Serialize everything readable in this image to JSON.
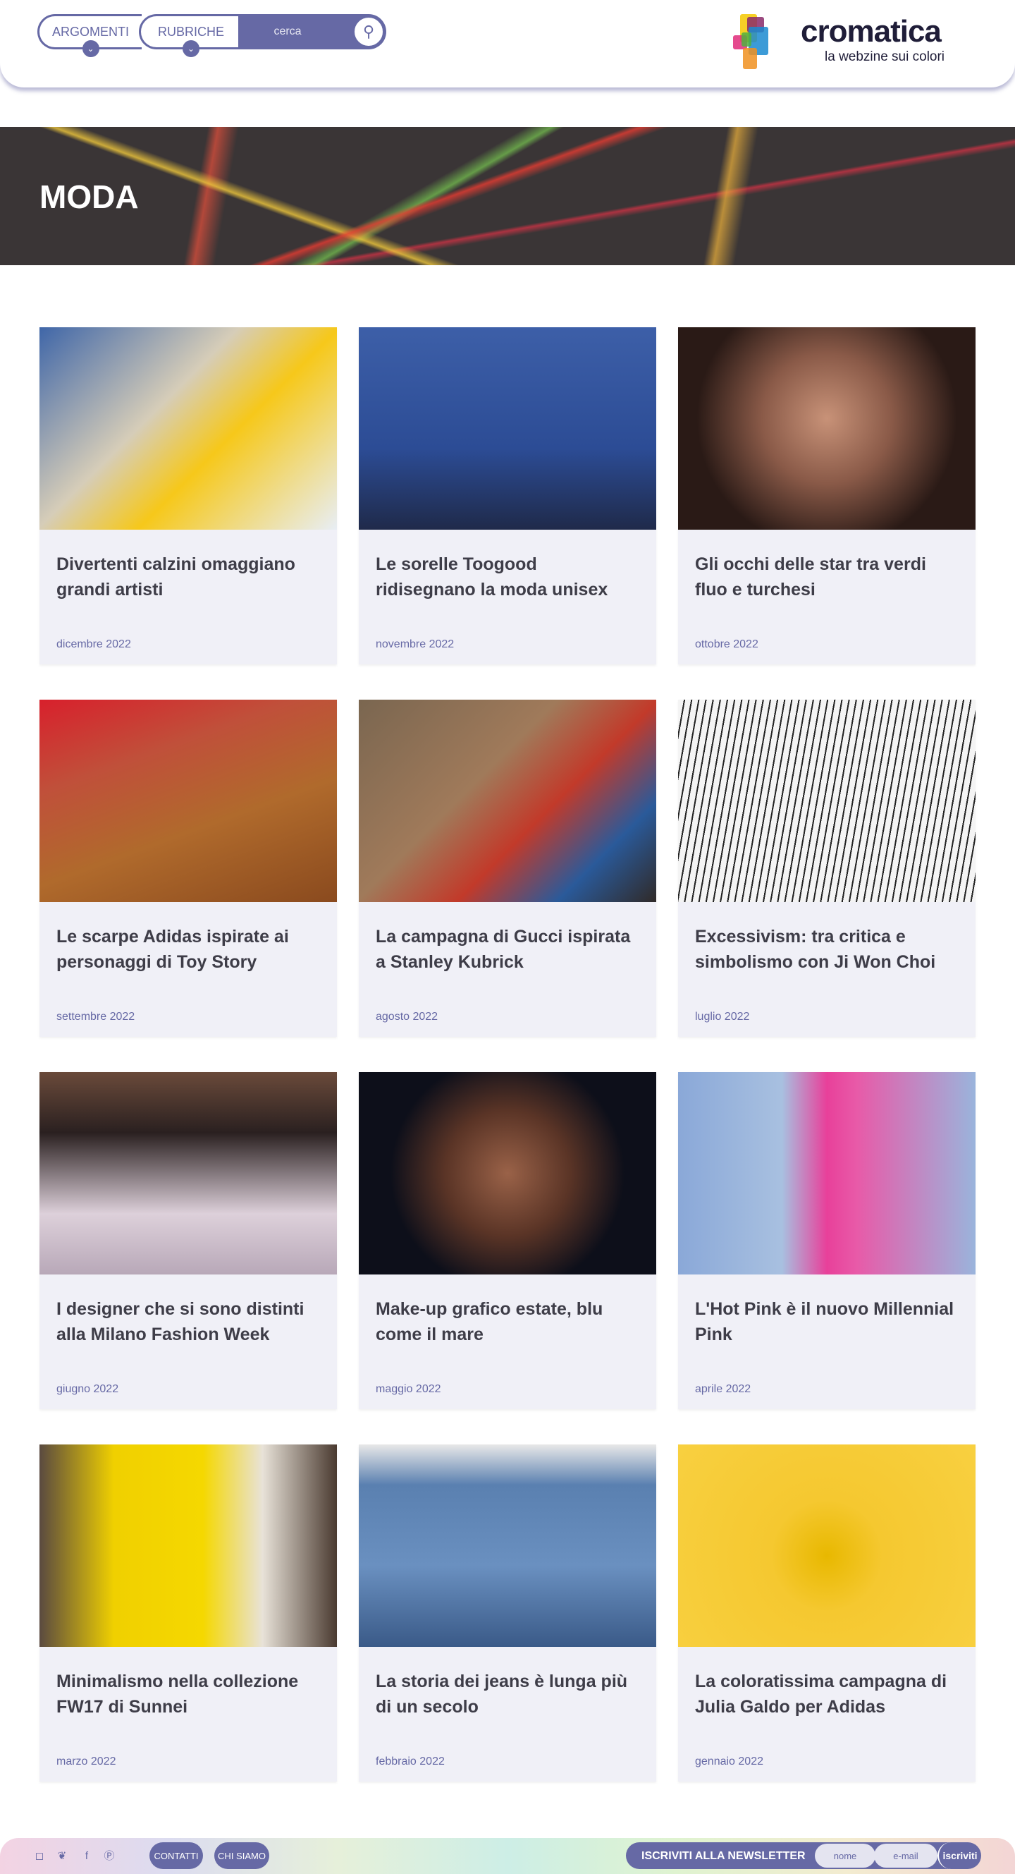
{
  "nav": {
    "argomenti": "ARGOMENTI",
    "rubriche": "RUBRICHE",
    "search_placeholder": "cerca"
  },
  "logo": {
    "name": "cromatica",
    "tagline": "la webzine sui colori"
  },
  "hero": {
    "title": "MODA"
  },
  "articles": [
    {
      "title": "Divertenti calzini omaggiano grandi artisti",
      "date": "dicembre 2022",
      "bg": "linear-gradient(135deg,#3f66a8 0%,#d6cdb8 40%,#f6c81a 60%,#e8eef5 100%)"
    },
    {
      "title": "Le sorelle Toogood ridisegnano la moda unisex",
      "date": "novembre 2022",
      "bg": "linear-gradient(180deg,#3d5fa8,#2c4c95 60%,#1f2a4a)"
    },
    {
      "title": "Gli occhi delle star tra verdi fluo e turchesi",
      "date": "ottobre 2022",
      "bg": "radial-gradient(circle at 50% 45%,#c89278 0%,#8a5a48 35%,#2a1a16 70%)"
    },
    {
      "title": "Le scarpe Adidas ispirate ai personaggi di Toy Story",
      "date": "settembre 2022",
      "bg": "linear-gradient(160deg,#d8202c 0%,#c0503a 30%,#b06a2c 60%,#8a4a1e 100%)"
    },
    {
      "title": "La campagna di Gucci ispirata a Stanley Kubrick",
      "date": "agosto 2022",
      "bg": "linear-gradient(135deg,#7a6650 0%,#a07a5a 40%,#c23a2a 60%,#2a5a9a 80%,#302a28 100%)"
    },
    {
      "title": "Excessivism: tra critica e simbolismo con Ji Won Choi",
      "date": "luglio 2022",
      "bg": "repeating-linear-gradient(100deg,#f4f4f4 0 8px,#222 8px 10px)"
    },
    {
      "title": "I designer che si sono distinti alla Milano Fashion Week",
      "date": "giugno 2022",
      "bg": "linear-gradient(180deg,#6a4a3a 0%,#2a2020 30%,#ddd0da 70%,#b8a8b8 100%)"
    },
    {
      "title": "Make-up grafico estate, blu come il mare",
      "date": "maggio 2022",
      "bg": "radial-gradient(circle at 50% 50%,#9a6248 0%,#5a3426 35%,#0d0f1a 65%)"
    },
    {
      "title": "L'Hot Pink è il nuovo Millennial Pink",
      "date": "aprile 2022",
      "bg": "linear-gradient(90deg,#8aa8d8 0%,#a8c0e0 35%,#e8409a 50%,#e85aa8 60%,#9ab4dc 100%)"
    },
    {
      "title": "Minimalismo nella collezione FW17 di Sunnei",
      "date": "marzo 2022",
      "bg": "linear-gradient(90deg,#5a4a40 0%,#f0d000 25%,#f5d800 55%,#e8e2d8 75%,#4a3a30 100%)"
    },
    {
      "title": "La storia dei jeans è lunga più di un secolo",
      "date": "febbraio 2022",
      "bg": "linear-gradient(180deg,#e8e8e8 0%,#5a80b0 20%,#6a90c0 60%,#3a5a88 100%)"
    },
    {
      "title": "La coloratissima campagna di Julia Galdo per Adidas",
      "date": "gennaio 2022",
      "bg": "radial-gradient(circle at 50% 55%,#e8b800 0%,#f5c830 30%,#f8d040 100%)"
    }
  ],
  "footer": {
    "contatti": "CONTATTI",
    "chi_siamo": "CHI SIAMO",
    "newsletter": "ISCRIVITI ALLA NEWSLETTER",
    "nome_placeholder": "nome",
    "email_placeholder": "e-mail",
    "iscriviti": "iscriviti"
  },
  "colors": {
    "accent": "#6669a5",
    "text": "#3e3d48",
    "card": "#f0f0f7"
  }
}
